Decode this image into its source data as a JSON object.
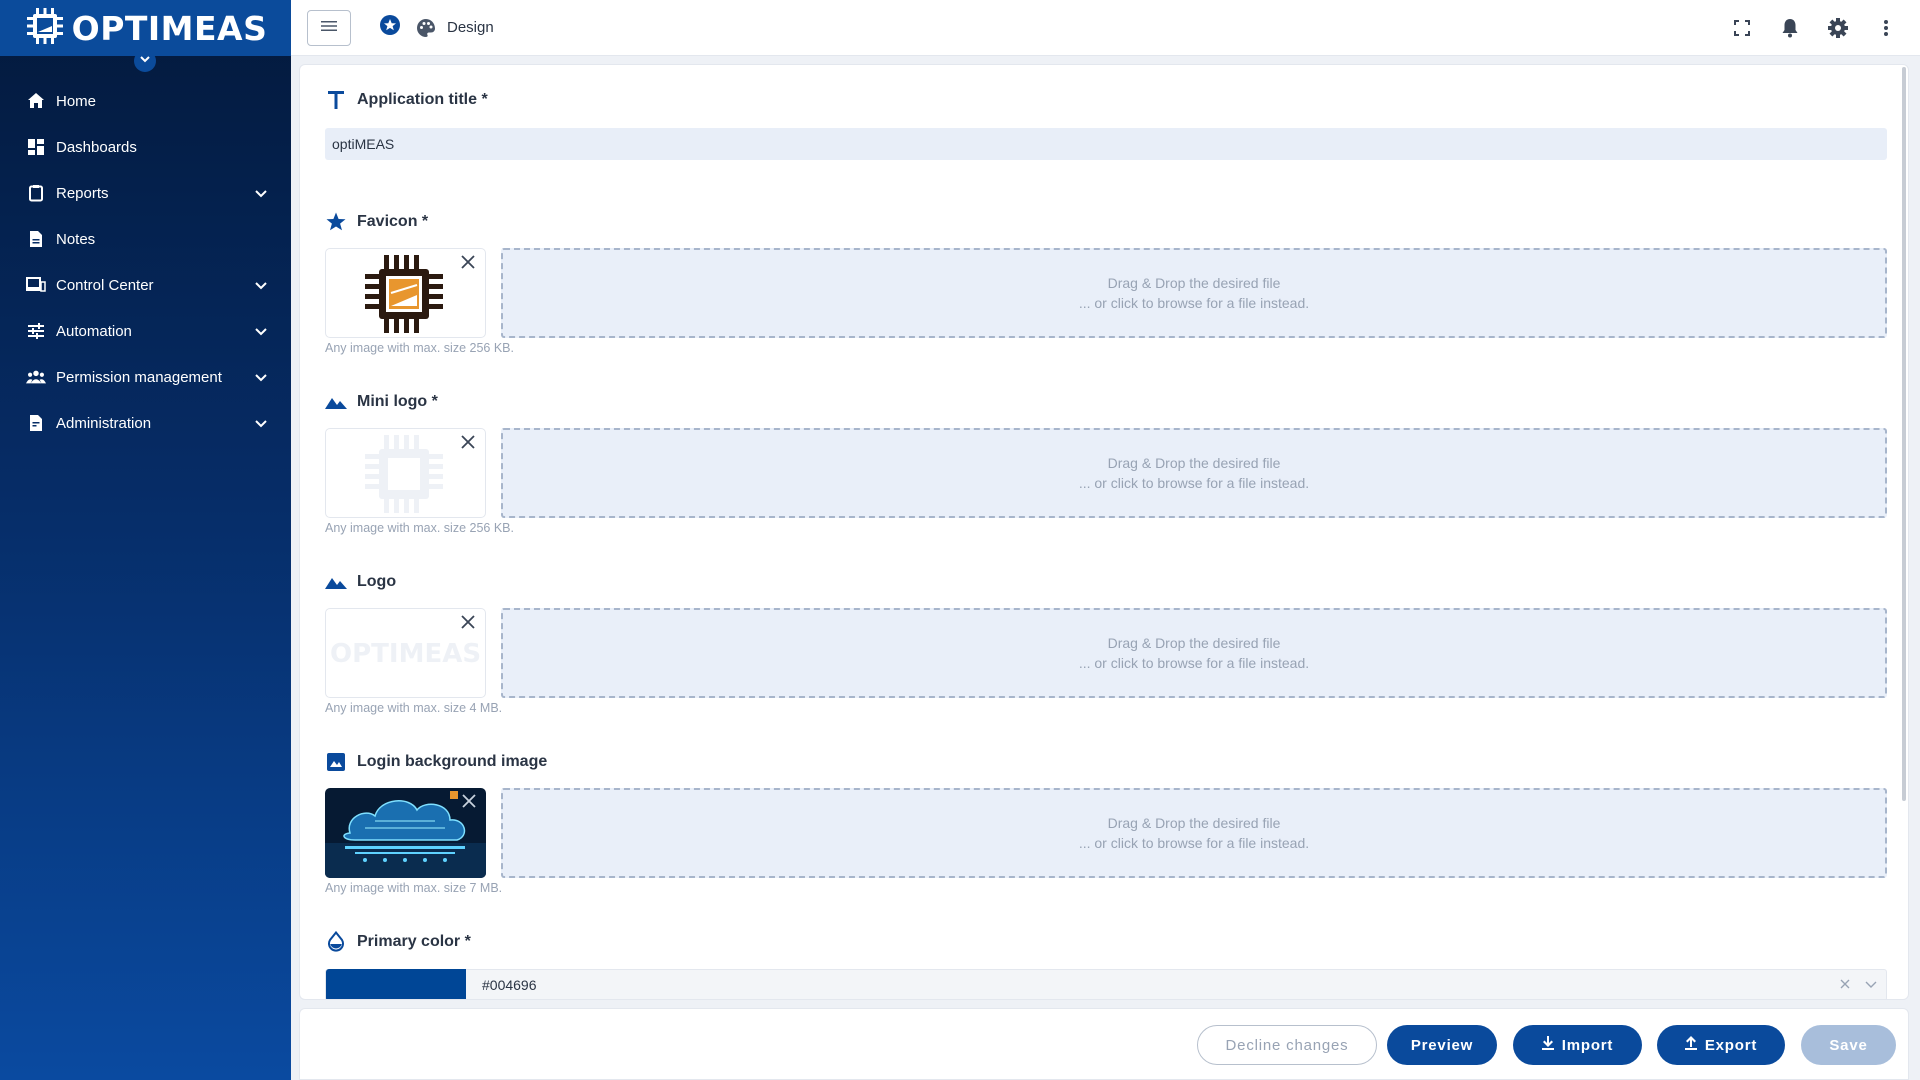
{
  "brand": {
    "name": "OPTIMEAS"
  },
  "sidebar": {
    "items": [
      {
        "label": "Home",
        "icon": "home-icon",
        "expandable": false
      },
      {
        "label": "Dashboards",
        "icon": "dashboard-icon",
        "expandable": false
      },
      {
        "label": "Reports",
        "icon": "clipboard-icon",
        "expandable": true
      },
      {
        "label": "Notes",
        "icon": "document-icon",
        "expandable": false
      },
      {
        "label": "Control Center",
        "icon": "devices-icon",
        "expandable": true
      },
      {
        "label": "Automation",
        "icon": "sliders-icon",
        "expandable": true
      },
      {
        "label": "Permission management",
        "icon": "people-icon",
        "expandable": true
      },
      {
        "label": "Administration",
        "icon": "admin-file-icon",
        "expandable": true
      }
    ]
  },
  "topbar": {
    "breadcrumb": "Design",
    "icons": [
      "fullscreen-icon",
      "bell-icon",
      "gear-icon",
      "more-vertical-icon"
    ]
  },
  "form": {
    "app_title": {
      "label": "Application title *",
      "value": "optiMEAS"
    },
    "favicon": {
      "label": "Favicon *",
      "hint": "Any image with max. size 256 KB."
    },
    "mini_logo": {
      "label": "Mini logo *",
      "hint": "Any image with max. size 256 KB."
    },
    "logo": {
      "label": "Logo",
      "hint": "Any image with max. size 4 MB.",
      "image_text": "OPTIMEAS"
    },
    "login_bg": {
      "label": "Login background image",
      "hint": "Any image with max. size 7 MB."
    },
    "dropzone": {
      "line1": "Drag & Drop the desired file",
      "line2": "... or click to browse for a file instead."
    },
    "primary_color": {
      "label": "Primary color *",
      "value": "#004696"
    }
  },
  "footer": {
    "decline": "Decline changes",
    "preview": "Preview",
    "import": "Import",
    "export": "Export",
    "save": "Save"
  },
  "colors": {
    "primary": "#004696",
    "sidebar_top": "#03193c",
    "sidebar_bottom": "#0a4aa0",
    "favicon_orange": "#e8962e",
    "favicon_dark": "#2b1a10"
  }
}
